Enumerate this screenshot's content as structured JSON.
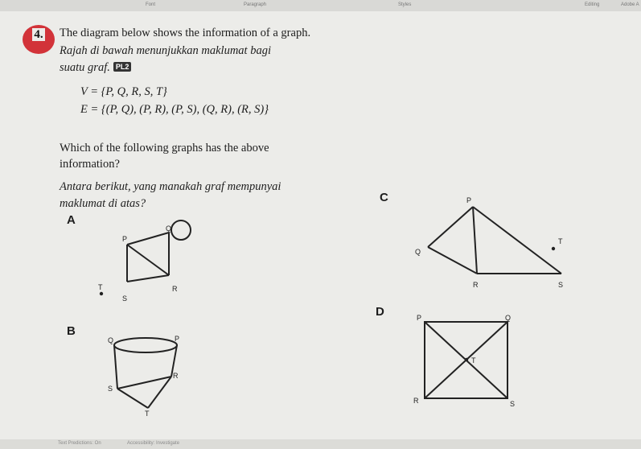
{
  "toolbar": {
    "font": "Font",
    "paragraph": "Paragraph",
    "styles": "Styles",
    "editing": "Editing",
    "adobe": "Adobe A"
  },
  "question": {
    "number": "4.",
    "english": "The diagram below shows the information of a graph.",
    "malay_line1": "Rajah di bawah menunjukkan maklumat bagi",
    "malay_line2": "suatu graf.",
    "level_badge": "PL2",
    "vertex_set": "V = {P, Q, R, S, T}",
    "edge_set": "E = {(P, Q), (P, R), (P, S), (Q, R), (R, S)}",
    "ask_en_line1": "Which of the following graphs has the above",
    "ask_en_line2": "information?",
    "ask_ms_line1": "Antara berikut, yang manakah graf mempunyai",
    "ask_ms_line2": "maklumat di atas?"
  },
  "options": [
    {
      "letter": "A",
      "vertex_labels": [
        "P",
        "Q",
        "R",
        "S",
        "T"
      ]
    },
    {
      "letter": "B",
      "vertex_labels": [
        "Q",
        "P",
        "R",
        "S",
        "T"
      ]
    },
    {
      "letter": "C",
      "vertex_labels": [
        "P",
        "Q",
        "T",
        "R",
        "S"
      ]
    },
    {
      "letter": "D",
      "vertex_labels": [
        "P",
        "Q",
        "T",
        "R",
        "S"
      ]
    }
  ],
  "status_bar": {
    "left": "Text Predictions: On",
    "accessibility": "Accessibility: Investigate"
  }
}
